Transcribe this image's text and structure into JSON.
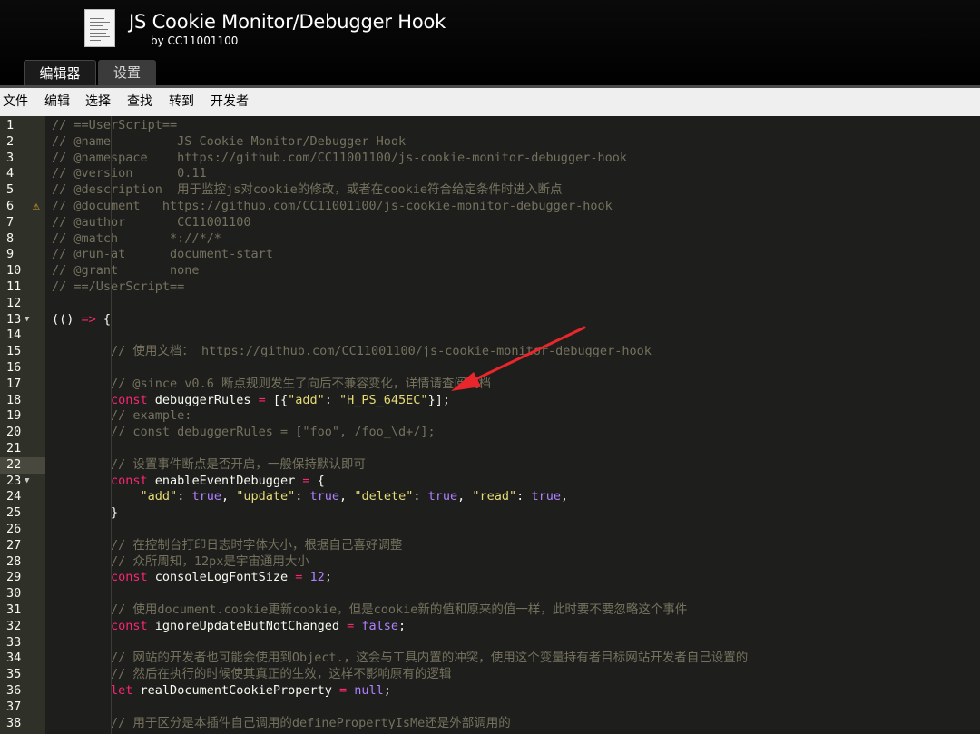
{
  "app": {
    "title": "JS Cookie Monitor/Debugger Hook",
    "subtitle": "by CC11001100"
  },
  "tabs": [
    {
      "label": "编辑器",
      "active": true
    },
    {
      "label": "设置",
      "active": false
    }
  ],
  "menu": [
    "文件",
    "编辑",
    "选择",
    "查找",
    "转到",
    "开发者"
  ],
  "colors": {
    "editor_bg": "#1e1f1c",
    "gutter_bg": "#2f3129",
    "active_line_bg": "#49483e",
    "comment": "#75715e",
    "keyword": "#f92672",
    "string": "#e6db74",
    "constant": "#ae81ff",
    "annotation_arrow": "#e8262b"
  },
  "editor": {
    "active_line": 22,
    "fold_lines": [
      13,
      23
    ],
    "warning_lines": [
      6
    ],
    "lines": [
      {
        "n": 1,
        "t": [
          [
            "c",
            "// ==UserScript=="
          ]
        ]
      },
      {
        "n": 2,
        "t": [
          [
            "c",
            "// @name         JS Cookie Monitor/Debugger Hook"
          ]
        ]
      },
      {
        "n": 3,
        "t": [
          [
            "c",
            "// @namespace    https://github.com/CC11001100/js-cookie-monitor-debugger-hook"
          ]
        ]
      },
      {
        "n": 4,
        "t": [
          [
            "c",
            "// @version      0.11"
          ]
        ]
      },
      {
        "n": 5,
        "t": [
          [
            "c",
            "// @description  用于监控js对cookie的修改，或者在cookie符合给定条件时进入断点"
          ]
        ]
      },
      {
        "n": 6,
        "t": [
          [
            "c",
            "// @document   https://github.com/CC11001100/js-cookie-monitor-debugger-hook"
          ]
        ]
      },
      {
        "n": 7,
        "t": [
          [
            "c",
            "// @author       CC11001100"
          ]
        ]
      },
      {
        "n": 8,
        "t": [
          [
            "c",
            "// @match       *://*/*"
          ]
        ]
      },
      {
        "n": 9,
        "t": [
          [
            "c",
            "// @run-at      document-start"
          ]
        ]
      },
      {
        "n": 10,
        "t": [
          [
            "c",
            "// @grant       none"
          ]
        ]
      },
      {
        "n": 11,
        "t": [
          [
            "c",
            "// ==/UserScript=="
          ]
        ]
      },
      {
        "n": 12,
        "t": []
      },
      {
        "n": 13,
        "t": [
          [
            "p",
            "(() "
          ],
          [
            "o",
            "=>"
          ],
          [
            "p",
            " {"
          ]
        ]
      },
      {
        "n": 14,
        "t": []
      },
      {
        "n": 15,
        "t": [
          [
            "p",
            "        "
          ],
          [
            "c",
            "// 使用文档： https://github.com/CC11001100/js-cookie-monitor-debugger-hook"
          ]
        ]
      },
      {
        "n": 16,
        "t": []
      },
      {
        "n": 17,
        "t": [
          [
            "p",
            "        "
          ],
          [
            "c",
            "// @since v0.6 断点规则发生了向后不兼容变化，详情请查阅文档"
          ]
        ]
      },
      {
        "n": 18,
        "t": [
          [
            "p",
            "        "
          ],
          [
            "k",
            "const"
          ],
          [
            "i",
            " debuggerRules "
          ],
          [
            "o",
            "="
          ],
          [
            "p",
            " [{"
          ],
          [
            "s",
            "\"add\""
          ],
          [
            "p",
            ": "
          ],
          [
            "s",
            "\"H_PS_645EC\""
          ],
          [
            "p",
            "}];"
          ]
        ]
      },
      {
        "n": 19,
        "t": [
          [
            "p",
            "        "
          ],
          [
            "c",
            "// example:"
          ]
        ]
      },
      {
        "n": 20,
        "t": [
          [
            "p",
            "        "
          ],
          [
            "c",
            "// const debuggerRules = [\"foo\", /foo_\\d+/];"
          ]
        ]
      },
      {
        "n": 21,
        "t": []
      },
      {
        "n": 22,
        "t": [
          [
            "p",
            "        "
          ],
          [
            "c",
            "// 设置事件断点是否开启，一般保持默认即可"
          ]
        ]
      },
      {
        "n": 23,
        "t": [
          [
            "p",
            "        "
          ],
          [
            "k",
            "const"
          ],
          [
            "i",
            " enableEventDebugger "
          ],
          [
            "o",
            "="
          ],
          [
            "p",
            " {"
          ]
        ]
      },
      {
        "n": 24,
        "t": [
          [
            "p",
            "            "
          ],
          [
            "s",
            "\"add\""
          ],
          [
            "p",
            ": "
          ],
          [
            "v",
            "true"
          ],
          [
            "p",
            ", "
          ],
          [
            "s",
            "\"update\""
          ],
          [
            "p",
            ": "
          ],
          [
            "v",
            "true"
          ],
          [
            "p",
            ", "
          ],
          [
            "s",
            "\"delete\""
          ],
          [
            "p",
            ": "
          ],
          [
            "v",
            "true"
          ],
          [
            "p",
            ", "
          ],
          [
            "s",
            "\"read\""
          ],
          [
            "p",
            ": "
          ],
          [
            "v",
            "true"
          ],
          [
            "p",
            ","
          ]
        ]
      },
      {
        "n": 25,
        "t": [
          [
            "p",
            "        }"
          ]
        ]
      },
      {
        "n": 26,
        "t": []
      },
      {
        "n": 27,
        "t": [
          [
            "p",
            "        "
          ],
          [
            "c",
            "// 在控制台打印日志时字体大小，根据自己喜好调整"
          ]
        ]
      },
      {
        "n": 28,
        "t": [
          [
            "p",
            "        "
          ],
          [
            "c",
            "// 众所周知，12px是宇宙通用大小"
          ]
        ]
      },
      {
        "n": 29,
        "t": [
          [
            "p",
            "        "
          ],
          [
            "k",
            "const"
          ],
          [
            "i",
            " consoleLogFontSize "
          ],
          [
            "o",
            "="
          ],
          [
            "p",
            " "
          ],
          [
            "v",
            "12"
          ],
          [
            "p",
            ";"
          ]
        ]
      },
      {
        "n": 30,
        "t": []
      },
      {
        "n": 31,
        "t": [
          [
            "p",
            "        "
          ],
          [
            "c",
            "// 使用document.cookie更新cookie，但是cookie新的值和原来的值一样，此时要不要忽略这个事件"
          ]
        ]
      },
      {
        "n": 32,
        "t": [
          [
            "p",
            "        "
          ],
          [
            "k",
            "const"
          ],
          [
            "i",
            " ignoreUpdateButNotChanged "
          ],
          [
            "o",
            "="
          ],
          [
            "p",
            " "
          ],
          [
            "v",
            "false"
          ],
          [
            "p",
            ";"
          ]
        ]
      },
      {
        "n": 33,
        "t": []
      },
      {
        "n": 34,
        "t": [
          [
            "p",
            "        "
          ],
          [
            "c",
            "// 网站的开发者也可能会使用到Object.，这会与工具内置的冲突，使用这个变量持有者目标网站开发者自己设置的"
          ]
        ]
      },
      {
        "n": 35,
        "t": [
          [
            "p",
            "        "
          ],
          [
            "c",
            "// 然后在执行的时候使其真正的生效，这样不影响原有的逻辑"
          ]
        ]
      },
      {
        "n": 36,
        "t": [
          [
            "p",
            "        "
          ],
          [
            "k",
            "let"
          ],
          [
            "i",
            " realDocumentCookieProperty "
          ],
          [
            "o",
            "="
          ],
          [
            "p",
            " "
          ],
          [
            "v",
            "null"
          ],
          [
            "p",
            ";"
          ]
        ]
      },
      {
        "n": 37,
        "t": []
      },
      {
        "n": 38,
        "t": [
          [
            "p",
            "        "
          ],
          [
            "c",
            "// 用于区分是本插件自己调用的definePropertyIsMe还是外部调用的"
          ]
        ]
      }
    ]
  }
}
